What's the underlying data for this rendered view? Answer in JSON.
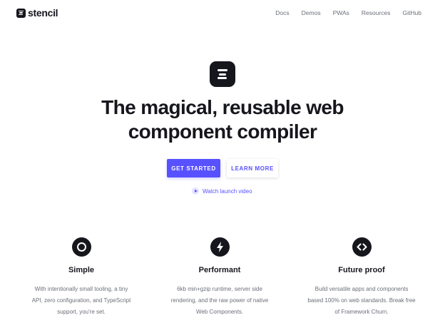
{
  "header": {
    "logo_text": "stencil",
    "nav": [
      "Docs",
      "Demos",
      "PWAs",
      "Resources",
      "GitHub"
    ]
  },
  "hero": {
    "headline_line1": "The magical, reusable web",
    "headline_line2": "component compiler",
    "primary_button": "GET STARTED",
    "secondary_button": "LEARN MORE",
    "video_link": "Watch launch video"
  },
  "features": [
    {
      "icon": "circle-ring-icon",
      "title": "Simple",
      "desc": [
        "With intentionally small tooling, a tiny",
        "API, zero configuration, and TypeScript",
        "support, you're set."
      ]
    },
    {
      "icon": "lightning-bolt-icon",
      "title": "Performant",
      "desc": [
        "6kb min+gzip runtime, server side",
        "rendering, and the raw power of native",
        "Web Components."
      ]
    },
    {
      "icon": "code-brackets-icon",
      "title": "Future proof",
      "desc": [
        "Build versatile apps and components",
        "based 100% on web standards. Break free",
        "of Framework Churn."
      ]
    }
  ],
  "colors": {
    "accent": "#5851ff",
    "dark": "#16161d",
    "muted_text": "#6b6f7a"
  }
}
